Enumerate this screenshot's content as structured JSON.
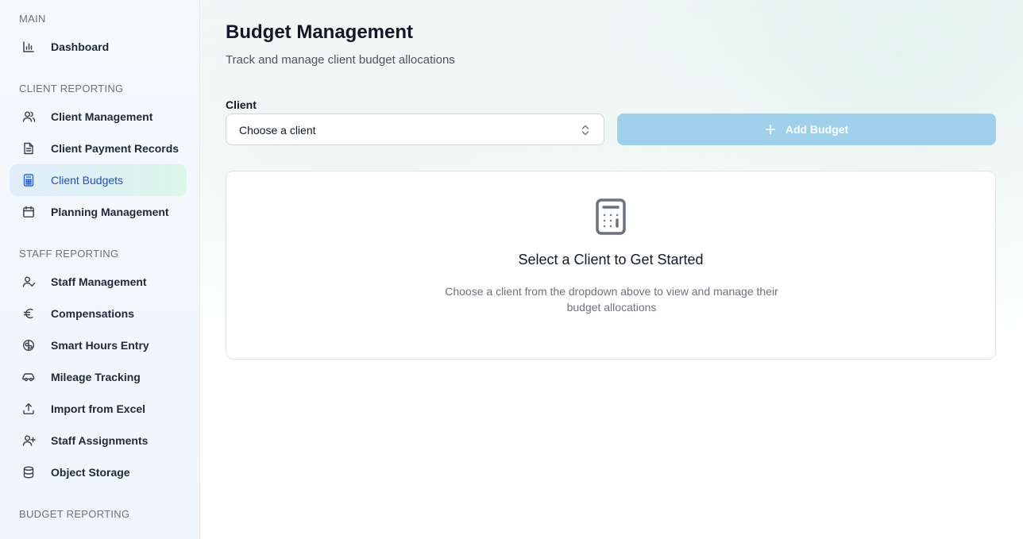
{
  "sidebar": {
    "sections": {
      "main": "MAIN",
      "client_reporting": "CLIENT REPORTING",
      "staff_reporting": "STAFF REPORTING",
      "budget_reporting": "BUDGET REPORTING"
    },
    "items": {
      "dashboard": {
        "label": "Dashboard",
        "icon": "bar-chart-icon"
      },
      "client_management": {
        "label": "Client Management",
        "icon": "users-icon"
      },
      "client_payment_records": {
        "label": "Client Payment Records",
        "icon": "document-icon"
      },
      "client_budgets": {
        "label": "Client Budgets",
        "icon": "calculator-icon",
        "active": true
      },
      "planning_management": {
        "label": "Planning Management",
        "icon": "calendar-icon"
      },
      "staff_management": {
        "label": "Staff Management",
        "icon": "user-check-icon"
      },
      "compensations": {
        "label": "Compensations",
        "icon": "euro-icon"
      },
      "smart_hours_entry": {
        "label": "Smart Hours Entry",
        "icon": "brain-icon"
      },
      "mileage_tracking": {
        "label": "Mileage Tracking",
        "icon": "car-icon"
      },
      "import_from_excel": {
        "label": "Import from Excel",
        "icon": "upload-icon"
      },
      "staff_assignments": {
        "label": "Staff Assignments",
        "icon": "user-plus-icon"
      },
      "object_storage": {
        "label": "Object Storage",
        "icon": "database-icon"
      }
    }
  },
  "header": {
    "title": "Budget Management",
    "subtitle": "Track and manage client budget allocations"
  },
  "client_select": {
    "label": "Client",
    "value": "Choose a client"
  },
  "add_budget": {
    "label": "Add Budget",
    "disabled": true
  },
  "empty_state": {
    "icon": "calculator-icon",
    "title": "Select a Client to Get Started",
    "description": "Choose a client from the dropdown above to view and manage their budget allocations"
  },
  "colors": {
    "accent": "#2563eb",
    "active_bg_start": "#e0edfb",
    "active_bg_end": "#dcf6ea",
    "add_button_disabled": "#9ed0ec"
  }
}
